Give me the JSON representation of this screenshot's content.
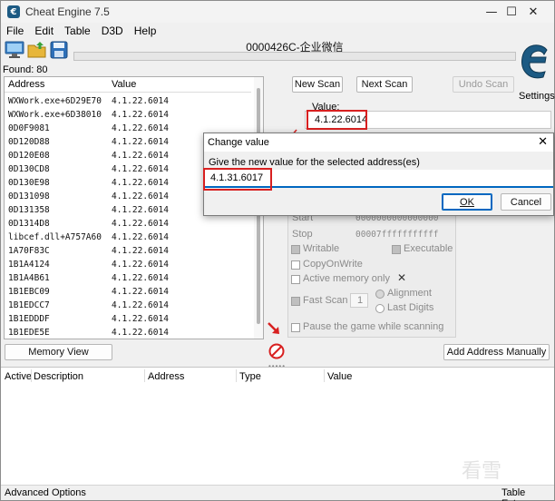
{
  "window": {
    "title": "Cheat Engine 7.5",
    "icon_text": "€",
    "controls": {
      "minimize": "—",
      "maximize": "☐",
      "close": "✕"
    }
  },
  "menu": [
    "File",
    "Edit",
    "Table",
    "D3D",
    "Help"
  ],
  "toolbar": {
    "process_title": "0000426C-企业微信"
  },
  "settings": {
    "label": "Settings"
  },
  "found": "Found: 80",
  "results": {
    "headers": {
      "address": "Address",
      "value": "Value"
    },
    "rows": [
      {
        "address": "WXWork.exe+6D29E70",
        "value": "4.1.22.6014"
      },
      {
        "address": "WXWork.exe+6D38010",
        "value": "4.1.22.6014"
      },
      {
        "address": "0D0F9081",
        "value": "4.1.22.6014"
      },
      {
        "address": "0D120D88",
        "value": "4.1.22.6014"
      },
      {
        "address": "0D120E08",
        "value": "4.1.22.6014"
      },
      {
        "address": "0D130CD8",
        "value": "4.1.22.6014"
      },
      {
        "address": "0D130E98",
        "value": "4.1.22.6014"
      },
      {
        "address": "0D131098",
        "value": "4.1.22.6014"
      },
      {
        "address": "0D131358",
        "value": "4.1.22.6014"
      },
      {
        "address": "0D1314D8",
        "value": "4.1.22.6014"
      },
      {
        "address": "libcef.dll+A757A60",
        "value": "4.1.22.6014"
      },
      {
        "address": "1A70F83C",
        "value": "4.1.22.6014"
      },
      {
        "address": "1B1A4124",
        "value": "4.1.22.6014"
      },
      {
        "address": "1B1A4B61",
        "value": "4.1.22.6014"
      },
      {
        "address": "1B1EBC09",
        "value": "4.1.22.6014"
      },
      {
        "address": "1B1EDCC7",
        "value": "4.1.22.6014"
      },
      {
        "address": "1B1EDDDF",
        "value": "4.1.22.6014"
      },
      {
        "address": "1B1EDE5E",
        "value": "4.1.22.6014"
      }
    ]
  },
  "scan": {
    "new_scan": "New Scan",
    "next_scan": "Next Scan",
    "undo_scan": "Undo Scan",
    "value_label": "Value:",
    "value": "4.1.22.6014"
  },
  "scan_options": {
    "start_label": "Start",
    "start_value": "0000000000000000",
    "stop_label": "Stop",
    "stop_value": "00007fffffffffff",
    "writable": "Writable",
    "executable": "Executable",
    "copy_on_write": "CopyOnWrite",
    "active_memory_only": "Active memory only",
    "fast_scan": "Fast Scan",
    "fast_scan_value": "1",
    "alignment": "Alignment",
    "last_digits": "Last Digits",
    "pause_game": "Pause the game while scanning"
  },
  "dialog": {
    "title": "Change value",
    "prompt": "Give the new value for the selected address(es)",
    "value": "4.1.31.6017",
    "ok": "OK",
    "cancel": "Cancel",
    "close": "✕"
  },
  "memory_view": "Memory View",
  "add_address_manually": "Add Address Manually",
  "address_table": {
    "headers": [
      "Active",
      "Description",
      "Address",
      "Type",
      "Value"
    ]
  },
  "status": {
    "left": "Advanced Options",
    "right": "Table Extras"
  },
  "watermark": "看雪",
  "colors": {
    "highlight_red": "#d82020",
    "accent_blue": "#0067c0",
    "logo_blue": "#1c5a83"
  }
}
